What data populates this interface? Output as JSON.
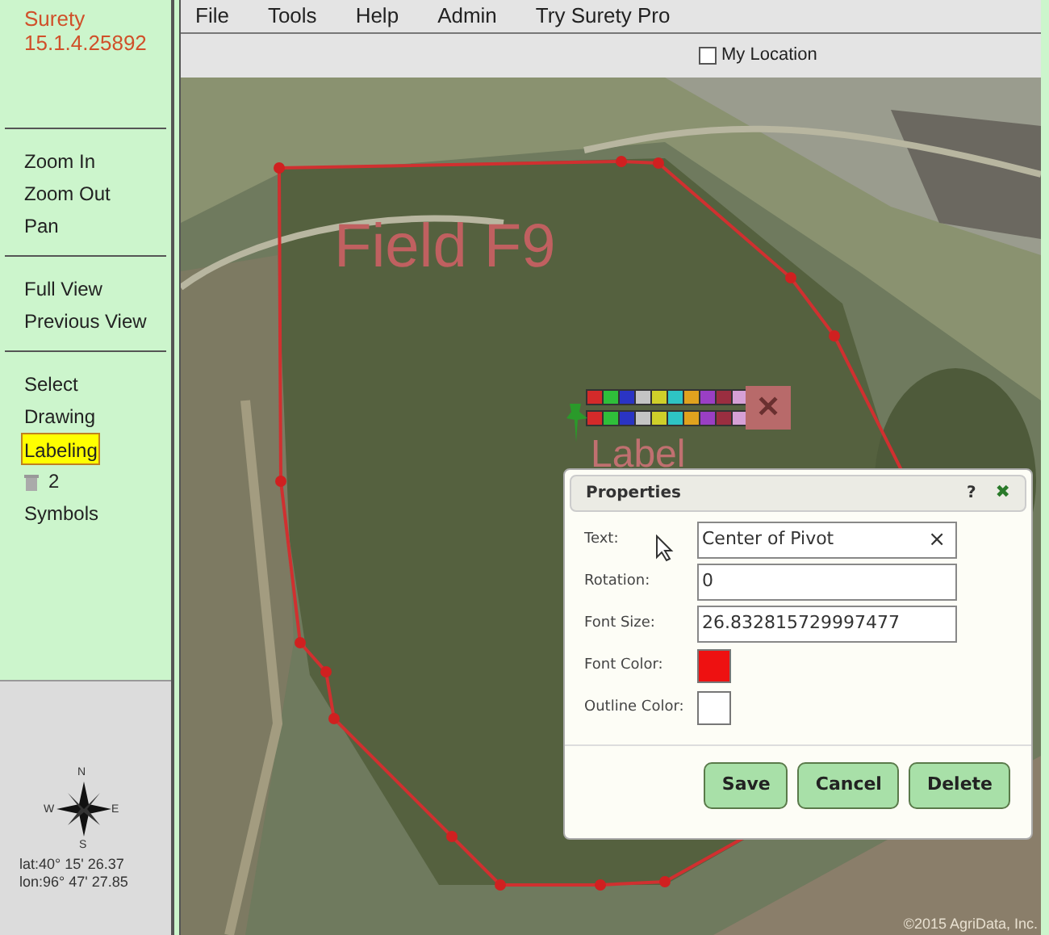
{
  "sidebar": {
    "app_name": "Surety",
    "version": "15.1.4.25892",
    "groups": [
      {
        "items": [
          {
            "kind": "text",
            "label": "Zoom In",
            "selected": false
          },
          {
            "kind": "text",
            "label": "Zoom Out",
            "selected": false
          },
          {
            "kind": "text",
            "label": "Pan",
            "selected": false
          }
        ]
      },
      {
        "items": [
          {
            "kind": "text",
            "label": "Full View",
            "selected": false
          },
          {
            "kind": "text",
            "label": "Previous View",
            "selected": false
          }
        ]
      },
      {
        "items": [
          {
            "kind": "text",
            "label": "Select",
            "selected": false
          },
          {
            "kind": "text",
            "label": "Drawing",
            "selected": false
          },
          {
            "kind": "text",
            "label": "Labeling",
            "selected": true
          },
          {
            "kind": "trash",
            "label": "2",
            "selected": false
          },
          {
            "kind": "text",
            "label": "Symbols",
            "selected": false
          }
        ]
      }
    ],
    "compass": {
      "n": "N",
      "s": "S",
      "e": "E",
      "w": "W"
    },
    "lat": "lat:40° 15' 26.37",
    "lon": "lon:96° 47' 27.85"
  },
  "menu": [
    "File",
    "Tools",
    "Help",
    "Admin",
    "Try Surety Pro"
  ],
  "toolbar": {
    "my_location": {
      "label": "My Location",
      "checked": false
    }
  },
  "map": {
    "field_label": "Field F9",
    "pending_label": "Label",
    "copyright": "©2015 AgriData, Inc.",
    "palette": [
      {
        "swatches": [
          {
            "color": "#d42a2a"
          },
          {
            "color": "#2fbf3a"
          },
          {
            "color": "#2a34c4"
          },
          {
            "color": "#c4c4c4"
          },
          {
            "color": "#cfcf2a"
          },
          {
            "color": "#2ec4c4"
          },
          {
            "color": "#e0a21e"
          },
          {
            "color": "#9a3fc4"
          },
          {
            "color": "#9a2e40"
          },
          {
            "color": "#d6a0d6"
          }
        ]
      },
      {
        "swatches": [
          {
            "color": "#d42a2a"
          },
          {
            "color": "#2fbf3a"
          },
          {
            "color": "#2a34c4"
          },
          {
            "color": "#c4c4c4"
          },
          {
            "color": "#cfcf2a"
          },
          {
            "color": "#2ec4c4"
          },
          {
            "color": "#e0a21e"
          },
          {
            "color": "#9a3fc4"
          },
          {
            "color": "#9a2e40"
          },
          {
            "color": "#d6a0d6"
          }
        ]
      }
    ],
    "delete_symbol": "✕"
  },
  "dialog": {
    "title": "Properties",
    "help": "?",
    "close": "✖",
    "fields": [
      {
        "kind": "text",
        "label": "Text:",
        "value": "Center of Pivot",
        "clear": "×"
      },
      {
        "kind": "text",
        "label": "Rotation:",
        "value": "0"
      },
      {
        "kind": "text",
        "label": "Font Size:",
        "value": "26.832815729997477"
      },
      {
        "kind": "color",
        "label": "Font Color:",
        "color": "#ee1111"
      },
      {
        "kind": "color",
        "label": "Outline Color:",
        "color": "#ffffff"
      }
    ],
    "buttons": [
      "Save",
      "Cancel",
      "Delete"
    ]
  }
}
